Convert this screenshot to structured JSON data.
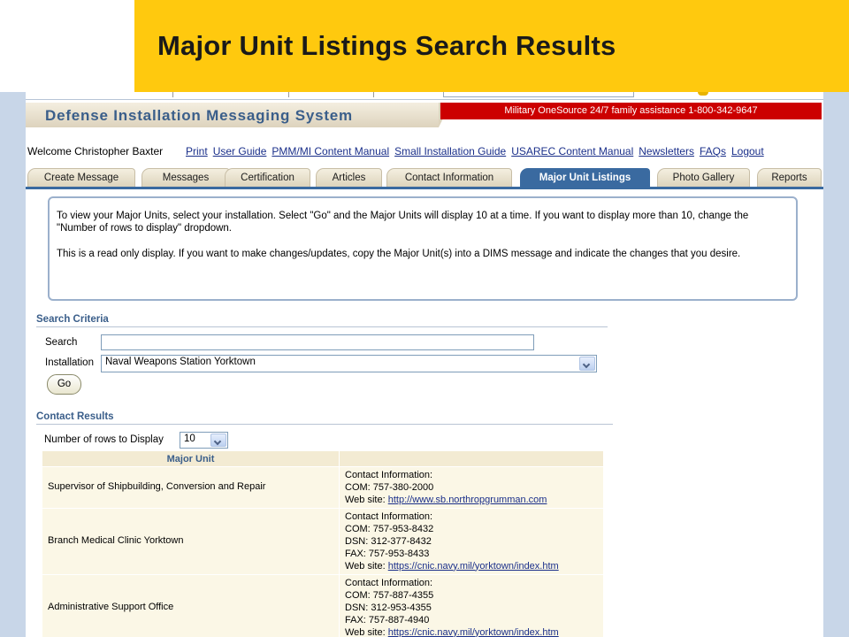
{
  "slide": {
    "title": "Major Unit Listings Search Results"
  },
  "app": {
    "title": "Defense Installation Messaging System",
    "assistance": "Military OneSource 24/7 family assistance 1-800-342-9647"
  },
  "user": {
    "welcome": "Welcome Christopher Baxter"
  },
  "nav_links": [
    "Print",
    "User Guide",
    "PMM/MI Content Manual",
    "Small Installation Guide",
    "USAREC Content Manual",
    "Newsletters",
    "FAQs",
    "Logout"
  ],
  "tabs": [
    "Create Message",
    "Messages",
    "Certification",
    "Articles",
    "Contact Information",
    "Major Unit Listings",
    "Photo Gallery",
    "Reports"
  ],
  "active_tab": "Major Unit Listings",
  "info": {
    "p1": "To view your Major Units, select your installation. Select \"Go\" and the Major Units will display 10 at a time. If you want to display more than 10, change the \"Number of rows to display\" dropdown.",
    "p2": "This is a read only display. If you want to make changes/updates, copy the Major Unit(s) into a DIMS message and indicate the changes that you desire."
  },
  "search_criteria": {
    "heading": "Search Criteria",
    "search_label": "Search",
    "search_value": "",
    "installation_label": "Installation",
    "installation_value": "Naval Weapons Station Yorktown",
    "go_label": "Go"
  },
  "contact_results": {
    "heading": "Contact Results",
    "rows_label": "Number of rows to Display",
    "rows_value": "10",
    "column_header": "Major Unit",
    "rows": [
      {
        "unit": "Supervisor of Shipbuilding, Conversion and Repair",
        "contact_header": "Contact Information:",
        "com": "COM: 757-380-2000",
        "web_label": "Web site:",
        "web_url": "http://www.sb.northropgrumman.com"
      },
      {
        "unit": "Branch Medical Clinic Yorktown",
        "contact_header": "Contact Information:",
        "com": "COM: 757-953-8432",
        "dsn": "DSN: 312-377-8432",
        "fax": "FAX: 757-953-8433",
        "web_label": "Web site:",
        "web_url": "https://cnic.navy.mil/yorktown/index.htm"
      },
      {
        "unit": "Administrative Support Office",
        "contact_header": "Contact Information:",
        "com": "COM: 757-887-4355",
        "dsn": "DSN: 312-953-4355",
        "fax": "FAX: 757-887-4940",
        "web_label": "Web site:",
        "web_url": "https://cnic.navy.mil/yorktown/index.htm"
      }
    ]
  },
  "colors": {
    "banner": "#ffc90e",
    "active_tab": "#3a6aa0",
    "assist_bar": "#cc0000",
    "heading_blue": "#3a5e8a"
  }
}
